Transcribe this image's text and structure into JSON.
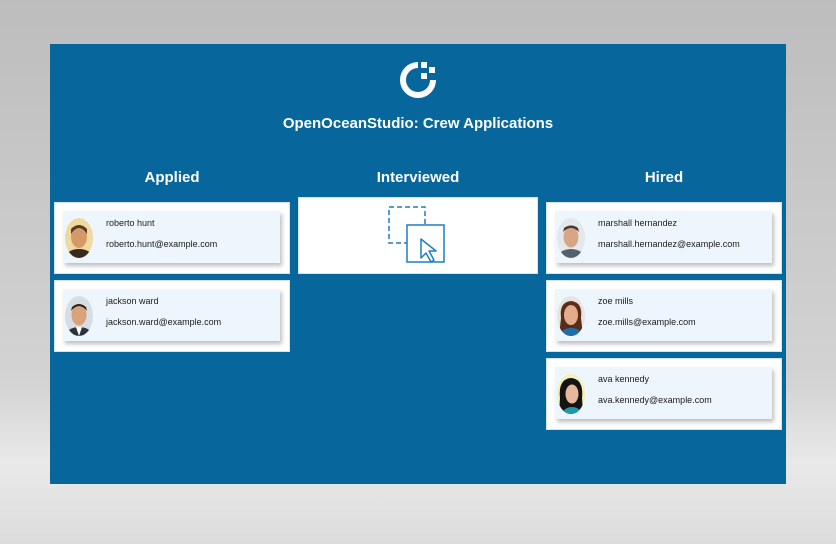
{
  "app": {
    "title": "OpenOceanStudio: Crew Applications",
    "logo_icon": "openocean-logo-icon"
  },
  "colors": {
    "board_bg": "#07679c",
    "card_bg": "#eef6fd",
    "accent": "#1f7fc2"
  },
  "columns": [
    {
      "heading": "Applied",
      "candidates": [
        {
          "name": "roberto hunt",
          "email": "roberto.hunt@example.com"
        },
        {
          "name": "jackson ward",
          "email": "jackson.ward@example.com"
        }
      ]
    },
    {
      "heading": "Interviewed",
      "candidates": [],
      "empty_icon": "drag-drop-icon"
    },
    {
      "heading": "Hired",
      "candidates": [
        {
          "name": "marshall hernandez",
          "email": "marshall.hernandez@example.com"
        },
        {
          "name": "zoe mills",
          "email": "zoe.mills@example.com"
        },
        {
          "name": "ava kennedy",
          "email": "ava.kennedy@example.com"
        }
      ]
    }
  ]
}
